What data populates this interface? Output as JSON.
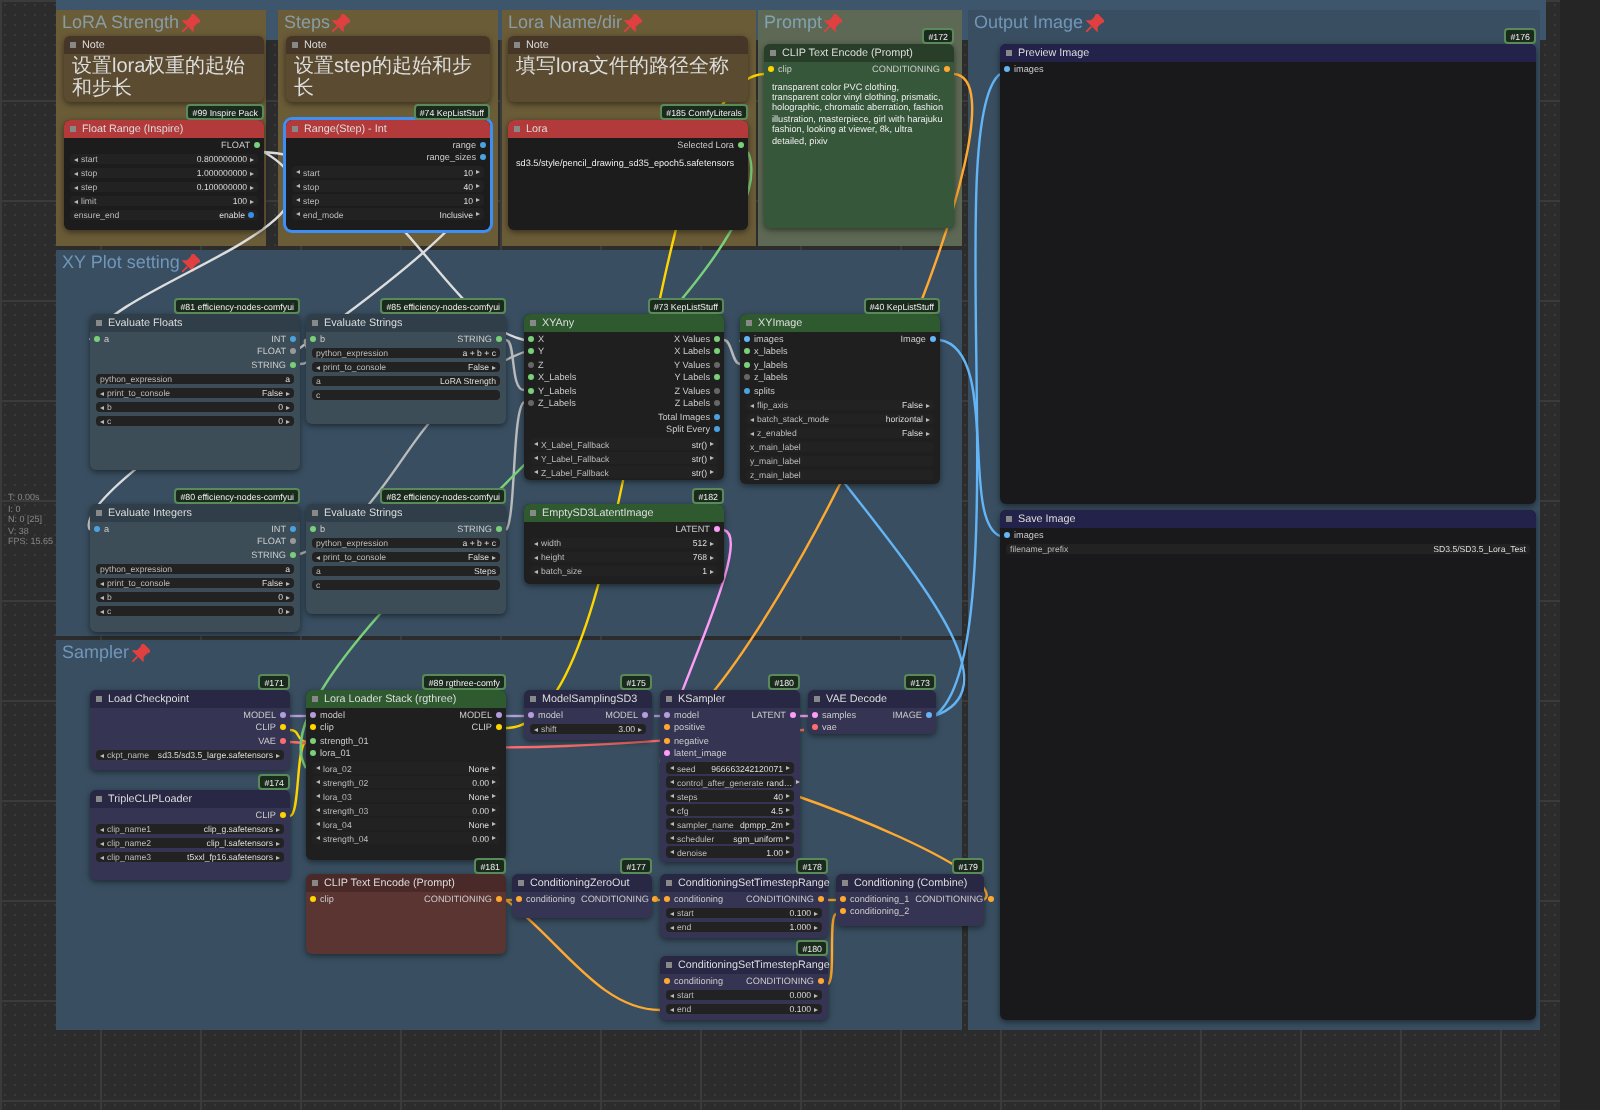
{
  "groups": [
    {
      "title": "LoRA Strength",
      "color": "#6b5c38"
    },
    {
      "title": "Steps",
      "color": "#6b5c38"
    },
    {
      "title": "Lora Name/dir",
      "color": "#6b5c38"
    },
    {
      "title": "Prompt",
      "color": "#5d6954"
    },
    {
      "title": "Output Image",
      "color": "#394f61"
    },
    {
      "title": "XY Plot setting",
      "color": "#394f61"
    },
    {
      "title": "Sampler",
      "color": "#394f61"
    }
  ],
  "nodes": [
    {
      "title": "Note",
      "kind": "note",
      "selected": false,
      "text": "设置lora权重的起始和步长"
    },
    {
      "title": "Float Range (Inspire)",
      "kind": "red",
      "badge": "#99 Inspire Pack",
      "selected": false,
      "outputs": [
        {
          "name": "FLOAT",
          "color": "#7ad07a"
        }
      ],
      "widgets": [
        {
          "name": "start",
          "value": "0.800000000",
          "kind": "number"
        },
        {
          "name": "stop",
          "value": "1.000000000",
          "kind": "number"
        },
        {
          "name": "step",
          "value": "0.100000000",
          "kind": "number"
        },
        {
          "name": "limit",
          "value": "100",
          "kind": "number"
        },
        {
          "name": "ensure_end",
          "value": "enable",
          "kind": "toggle"
        }
      ]
    },
    {
      "title": "Note",
      "kind": "note",
      "selected": false,
      "text": "设置step的起始和步长"
    },
    {
      "title": "Range(Step) - Int",
      "kind": "red",
      "badge": "#74 KepListStuff",
      "selected": true,
      "outputs": [
        {
          "name": "range",
          "color": "#4aa3df"
        },
        {
          "name": "range_sizes",
          "color": "#4aa3df"
        }
      ],
      "widgets": [
        {
          "name": "start",
          "value": "10",
          "kind": "number"
        },
        {
          "name": "stop",
          "value": "40",
          "kind": "number"
        },
        {
          "name": "step",
          "value": "10",
          "kind": "number"
        },
        {
          "name": "end_mode",
          "value": "Inclusive",
          "kind": "number"
        }
      ]
    },
    {
      "title": "Note",
      "kind": "note",
      "selected": false,
      "text": "填写lora文件的路径全称"
    },
    {
      "title": "Lora",
      "kind": "red",
      "badge": "#185 ComfyLiterals",
      "selected": false,
      "outputs": [
        {
          "name": "Selected Lora",
          "color": "#7ad07a"
        }
      ],
      "text": "sd3.5/style/pencil_drawing_sd35_epoch5.safetensors"
    },
    {
      "title": "CLIP Text Encode (Prompt)",
      "kind": "green_body",
      "badge": "#172",
      "selected": false,
      "inputs": [
        {
          "name": "clip",
          "color": "#ffd500"
        }
      ],
      "outputs": [
        {
          "name": "CONDITIONING",
          "color": "#ffa931"
        }
      ],
      "text": "transparent color PVC clothing, transparent color vinyl clothing, prismatic, holographic, chromatic aberration, fashion illustration, masterpiece, girl with harajuku fashion, looking at viewer, 8k, ultra detailed, pixiv"
    },
    {
      "title": "Preview Image",
      "kind": "preview",
      "badge": "#176",
      "selected": false,
      "inputs": [
        {
          "name": "images",
          "color": "#64b5f6"
        }
      ]
    },
    {
      "title": "Evaluate Floats",
      "kind": "slate",
      "badge": "#81 efficiency-nodes-comfyui",
      "selected": false,
      "inputs": [
        {
          "name": "a",
          "color": "#7ad07a"
        }
      ],
      "outputs": [
        {
          "name": "INT",
          "color": "#4aa3df"
        },
        {
          "name": "FLOAT",
          "color": "#999999"
        },
        {
          "name": "STRING",
          "color": "#7ad07a"
        }
      ],
      "widgets": [
        {
          "name": "python_expression",
          "value": "a",
          "kind": "text"
        },
        {
          "name": "print_to_console",
          "value": "False",
          "kind": "number"
        },
        {
          "name": "b",
          "value": "0",
          "kind": "number"
        },
        {
          "name": "c",
          "value": "0",
          "kind": "number"
        }
      ]
    },
    {
      "title": "Evaluate Strings",
      "kind": "slate",
      "badge": "#85 efficiency-nodes-comfyui",
      "selected": false,
      "inputs": [
        {
          "name": "b",
          "color": "#7ad07a"
        }
      ],
      "outputs": [
        {
          "name": "STRING",
          "color": "#7ad07a"
        }
      ],
      "widgets": [
        {
          "name": "python_expression",
          "value": "a + b + c",
          "kind": "text"
        },
        {
          "name": "print_to_console",
          "value": "False",
          "kind": "number"
        },
        {
          "name": "a",
          "value": "LoRA Strength",
          "kind": "text"
        },
        {
          "name": "c",
          "kind": "text"
        }
      ]
    },
    {
      "title": "Evaluate Integers",
      "kind": "slate",
      "badge": "#80 efficiency-nodes-comfyui",
      "selected": false,
      "inputs": [
        {
          "name": "a",
          "color": "#4aa3df"
        }
      ],
      "outputs": [
        {
          "name": "INT",
          "color": "#4aa3df"
        },
        {
          "name": "FLOAT",
          "color": "#999999"
        },
        {
          "name": "STRING",
          "color": "#7ad07a"
        }
      ],
      "widgets": [
        {
          "name": "python_expression",
          "value": "a",
          "kind": "text"
        },
        {
          "name": "print_to_console",
          "value": "False",
          "kind": "number"
        },
        {
          "name": "b",
          "value": "0",
          "kind": "number"
        },
        {
          "name": "c",
          "value": "0",
          "kind": "number"
        }
      ]
    },
    {
      "title": "Evaluate Strings",
      "kind": "slate",
      "badge": "#82 efficiency-nodes-comfyui",
      "selected": false,
      "inputs": [
        {
          "name": "b",
          "color": "#7ad07a"
        }
      ],
      "outputs": [
        {
          "name": "STRING",
          "color": "#7ad07a"
        }
      ],
      "widgets": [
        {
          "name": "python_expression",
          "value": "a + b + c",
          "kind": "text"
        },
        {
          "name": "print_to_console",
          "value": "False",
          "kind": "number"
        },
        {
          "name": "a",
          "value": "Steps",
          "kind": "text"
        },
        {
          "name": "c",
          "kind": "text"
        }
      ]
    },
    {
      "title": "XYAny",
      "kind": "green",
      "badge": "#73 KepListStuff",
      "selected": false,
      "inputs": [
        {
          "name": "X",
          "color": "#7ad07a"
        },
        {
          "name": "Y",
          "color": "#7ad07a"
        },
        {
          "name": "Z",
          "color": "#666666"
        },
        {
          "name": "X_Labels",
          "color": "#7ad07a"
        },
        {
          "name": "Y_Labels",
          "color": "#7ad07a"
        },
        {
          "name": "Z_Labels",
          "color": "#666666"
        }
      ],
      "outputs": [
        {
          "name": "X Values",
          "color": "#7ad07a"
        },
        {
          "name": "X Labels",
          "color": "#7ad07a"
        },
        {
          "name": "Y Values",
          "color": "#666666"
        },
        {
          "name": "Y Labels",
          "color": "#7ad07a"
        },
        {
          "name": "Z Values",
          "color": "#666666"
        },
        {
          "name": "Z Labels",
          "color": "#666666"
        },
        {
          "name": "Total Images",
          "color": "#4aa3df"
        },
        {
          "name": "Split Every",
          "color": "#4aa3df"
        }
      ],
      "widgets": [
        {
          "name": "X_Label_Fallback",
          "value": "str()",
          "kind": "number"
        },
        {
          "name": "Y_Label_Fallback",
          "value": "str()",
          "kind": "number"
        },
        {
          "name": "Z_Label_Fallback",
          "value": "str()",
          "kind": "number"
        }
      ]
    },
    {
      "title": "XYImage",
      "kind": "green",
      "badge": "#40 KepListStuff",
      "selected": false,
      "inputs": [
        {
          "name": "images",
          "color": "#64b5f6"
        },
        {
          "name": "x_labels",
          "color": "#7ad07a"
        },
        {
          "name": "y_labels",
          "color": "#7ad07a"
        },
        {
          "name": "z_labels",
          "color": "#666666"
        },
        {
          "name": "splits",
          "color": "#4aa3df"
        }
      ],
      "outputs": [
        {
          "name": "Image",
          "color": "#64b5f6"
        }
      ],
      "widgets": [
        {
          "name": "flip_axis",
          "value": "False",
          "kind": "number"
        },
        {
          "name": "batch_stack_mode",
          "value": "horizontal",
          "kind": "number"
        },
        {
          "name": "z_enabled",
          "value": "False",
          "kind": "number"
        },
        {
          "name": "x_main_label",
          "kind": "text"
        },
        {
          "name": "y_main_label",
          "kind": "text"
        },
        {
          "name": "z_main_label",
          "kind": "text"
        }
      ]
    },
    {
      "title": "EmptySD3LatentImage",
      "kind": "green",
      "badge": "#182",
      "selected": false,
      "outputs": [
        {
          "name": "LATENT",
          "color": "#ff9cf9"
        }
      ],
      "widgets": [
        {
          "name": "width",
          "value": "512",
          "kind": "number"
        },
        {
          "name": "height",
          "value": "768",
          "kind": "number"
        },
        {
          "name": "batch_size",
          "value": "1",
          "kind": "number"
        }
      ]
    },
    {
      "title": "Save Image",
      "kind": "preview",
      "selected": false,
      "inputs": [
        {
          "name": "images",
          "color": "#64b5f6"
        }
      ],
      "widgets": [
        {
          "name": "filename_prefix",
          "value": "SD3.5/SD3.5_Lora_Test",
          "kind": "text"
        }
      ]
    },
    {
      "title": "Load Checkpoint",
      "kind": "purple",
      "badge": "#171",
      "selected": false,
      "outputs": [
        {
          "name": "MODEL",
          "color": "#b39ddb"
        },
        {
          "name": "CLIP",
          "color": "#ffd500"
        },
        {
          "name": "VAE",
          "color": "#ff6e6e"
        }
      ],
      "widgets": [
        {
          "name": "ckpt_name",
          "value": "sd3.5/sd3.5_large.safetensors",
          "kind": "number"
        }
      ]
    },
    {
      "title": "TripleCLIPLoader",
      "kind": "purple",
      "badge": "#174",
      "selected": false,
      "outputs": [
        {
          "name": "CLIP",
          "color": "#ffd500"
        }
      ],
      "widgets": [
        {
          "name": "clip_name1",
          "value": "clip_g.safetensors",
          "kind": "number"
        },
        {
          "name": "clip_name2",
          "value": "clip_l.safetensors",
          "kind": "number"
        },
        {
          "name": "clip_name3",
          "value": "t5xxl_fp16.safetensors",
          "kind": "number"
        }
      ]
    },
    {
      "title": "Lora Loader Stack (rgthree)",
      "kind": "green",
      "badge": "#89 rgthree-comfy",
      "selected": false,
      "inputs": [
        {
          "name": "model",
          "color": "#b39ddb"
        },
        {
          "name": "clip",
          "color": "#ffd500"
        },
        {
          "name": "strength_01",
          "color": "#7ad07a"
        },
        {
          "name": "lora_01",
          "color": "#7ad07a"
        }
      ],
      "outputs": [
        {
          "name": "MODEL",
          "color": "#b39ddb"
        },
        {
          "name": "CLIP",
          "color": "#ffd500"
        }
      ],
      "widgets": [
        {
          "name": "lora_02",
          "value": "None",
          "kind": "number"
        },
        {
          "name": "strength_02",
          "value": "0.00",
          "kind": "number"
        },
        {
          "name": "lora_03",
          "value": "None",
          "kind": "number"
        },
        {
          "name": "strength_03",
          "value": "0.00",
          "kind": "number"
        },
        {
          "name": "lora_04",
          "value": "None",
          "kind": "number"
        },
        {
          "name": "strength_04",
          "value": "0.00",
          "kind": "number"
        }
      ]
    },
    {
      "title": "CLIP Text Encode (Prompt)",
      "kind": "brown",
      "badge": "#181",
      "selected": false,
      "inputs": [
        {
          "name": "clip",
          "color": "#ffd500"
        }
      ],
      "outputs": [
        {
          "name": "CONDITIONING",
          "color": "#ffa931"
        }
      ]
    },
    {
      "title": "ModelSamplingSD3",
      "kind": "purple",
      "badge": "#175",
      "selected": false,
      "inputs": [
        {
          "name": "model",
          "color": "#b39ddb"
        }
      ],
      "outputs": [
        {
          "name": "MODEL",
          "color": "#b39ddb"
        }
      ],
      "widgets": [
        {
          "name": "shift",
          "value": "3.00",
          "kind": "number"
        }
      ]
    },
    {
      "title": "KSampler",
      "kind": "purple",
      "badge": "#180",
      "selected": false,
      "inputs": [
        {
          "name": "model",
          "color": "#b39ddb"
        },
        {
          "name": "positive",
          "color": "#ffa931"
        },
        {
          "name": "negative",
          "color": "#ffa931"
        },
        {
          "name": "latent_image",
          "color": "#ff9cf9"
        }
      ],
      "outputs": [
        {
          "name": "LATENT",
          "color": "#ff9cf9"
        }
      ],
      "widgets": [
        {
          "name": "seed",
          "value": "966663242120071",
          "kind": "number"
        },
        {
          "name": "control_after_generate",
          "value": "rand…",
          "kind": "number"
        },
        {
          "name": "steps",
          "value": "40",
          "kind": "number"
        },
        {
          "name": "cfg",
          "value": "4.5",
          "kind": "number"
        },
        {
          "name": "sampler_name",
          "value": "dpmpp_2m",
          "kind": "number"
        },
        {
          "name": "scheduler",
          "value": "sgm_uniform",
          "kind": "number"
        },
        {
          "name": "denoise",
          "value": "1.00",
          "kind": "number"
        }
      ]
    },
    {
      "title": "VAE Decode",
      "kind": "purple",
      "badge": "#173",
      "selected": false,
      "inputs": [
        {
          "name": "samples",
          "color": "#ff9cf9"
        },
        {
          "name": "vae",
          "color": "#ff6e6e"
        }
      ],
      "outputs": [
        {
          "name": "IMAGE",
          "color": "#64b5f6"
        }
      ]
    },
    {
      "title": "ConditioningZeroOut",
      "kind": "purple",
      "badge": "#177",
      "selected": false,
      "inputs": [
        {
          "name": "conditioning",
          "color": "#ffa931"
        }
      ],
      "outputs": [
        {
          "name": "CONDITIONING",
          "color": "#ffa931"
        }
      ]
    },
    {
      "title": "ConditioningSetTimestepRange",
      "kind": "purple",
      "badge": "#178",
      "selected": false,
      "inputs": [
        {
          "name": "conditioning",
          "color": "#ffa931"
        }
      ],
      "outputs": [
        {
          "name": "CONDITIONING",
          "color": "#ffa931"
        }
      ],
      "widgets": [
        {
          "name": "start",
          "value": "0.100",
          "kind": "number"
        },
        {
          "name": "end",
          "value": "1.000",
          "kind": "number"
        }
      ]
    },
    {
      "title": "Conditioning (Combine)",
      "kind": "purple",
      "badge": "#179",
      "selected": false,
      "inputs": [
        {
          "name": "conditioning_1",
          "color": "#ffa931"
        },
        {
          "name": "conditioning_2",
          "color": "#ffa931"
        }
      ],
      "outputs": [
        {
          "name": "CONDITIONING",
          "color": "#ffa931"
        }
      ]
    },
    {
      "title": "ConditioningSetTimestepRange",
      "kind": "purple",
      "badge": "#180",
      "selected": false,
      "inputs": [
        {
          "name": "conditioning",
          "color": "#ffa931"
        }
      ],
      "outputs": [
        {
          "name": "CONDITIONING",
          "color": "#ffa931"
        }
      ],
      "widgets": [
        {
          "name": "start",
          "value": "0.000",
          "kind": "number"
        },
        {
          "name": "end",
          "value": "0.100",
          "kind": "number"
        }
      ]
    }
  ],
  "stats": [
    "T: 0.00s",
    "I: 0",
    "N: 0 [25]",
    "V: 38",
    "FPS: 15.65"
  ]
}
